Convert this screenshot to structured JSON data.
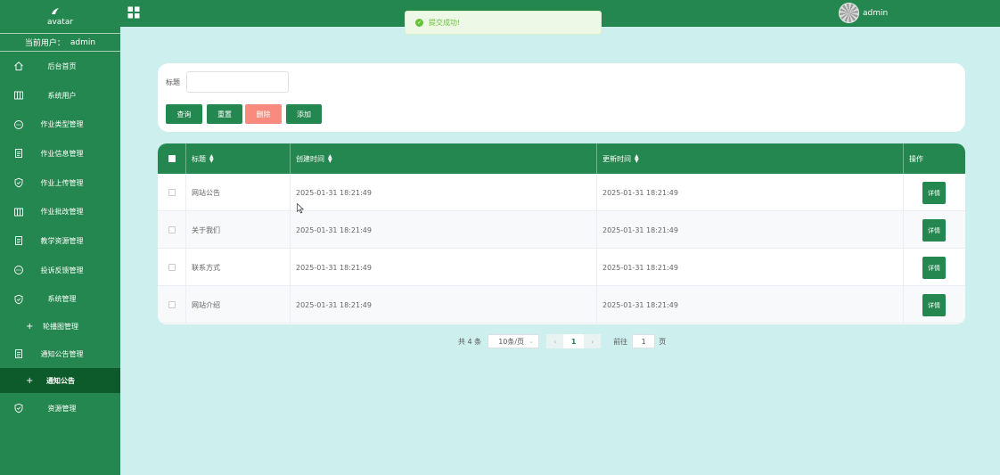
{
  "sidebar": {
    "logo_alt": "avatar",
    "current_user_label": "当前用户：",
    "current_user_name": "admin",
    "items": [
      {
        "label": "后台首页",
        "icon": "home-icon"
      },
      {
        "label": "系统用户",
        "icon": "columns-icon"
      },
      {
        "label": "作业类型管理",
        "icon": "chat-icon"
      },
      {
        "label": "作业信息管理",
        "icon": "document-icon"
      },
      {
        "label": "作业上传管理",
        "icon": "shield-icon"
      },
      {
        "label": "作业批改管理",
        "icon": "columns-icon"
      },
      {
        "label": "教学资源管理",
        "icon": "document-icon"
      },
      {
        "label": "投诉反馈管理",
        "icon": "chat-icon"
      },
      {
        "label": "系统管理",
        "icon": "shield-icon"
      },
      {
        "label": "轮播图管理",
        "icon": "plus-icon"
      },
      {
        "label": "通知公告管理",
        "icon": "document-icon"
      },
      {
        "label": "通知公告",
        "icon": "plus-icon"
      },
      {
        "label": "资源管理",
        "icon": "shield-icon"
      }
    ]
  },
  "topbar": {
    "title": "",
    "username": "admin"
  },
  "toast": {
    "message": "提交成功!"
  },
  "search": {
    "title_label": "标题",
    "title_value": "",
    "query_label": "查询",
    "reset_label": "重置",
    "delete_label": "删除",
    "add_label": "添加"
  },
  "table": {
    "headers": [
      "标题",
      "创建时间",
      "更新时间",
      "操作"
    ],
    "detail_label": "详情",
    "rows": [
      {
        "title": "网站公告",
        "created": "2025-01-31 18:21:49",
        "updated": "2025-01-31 18:21:49"
      },
      {
        "title": "关于我们",
        "created": "2025-01-31 18:21:49",
        "updated": "2025-01-31 18:21:49"
      },
      {
        "title": "联系方式",
        "created": "2025-01-31 18:21:49",
        "updated": "2025-01-31 18:21:49"
      },
      {
        "title": "网站介绍",
        "created": "2025-01-31 18:21:49",
        "updated": "2025-01-31 18:21:49"
      }
    ]
  },
  "pagination": {
    "total_text": "共 4 条",
    "page_size": "10条/页",
    "current_page": "1",
    "goto_label": "前往",
    "goto_value": "1",
    "page_suffix": "页"
  },
  "colors": {
    "primary": "#24874f",
    "active_menu": "#0d5a2a",
    "background": "#cdf0ee",
    "danger": "#f98a7e",
    "success": "#67c23a"
  }
}
